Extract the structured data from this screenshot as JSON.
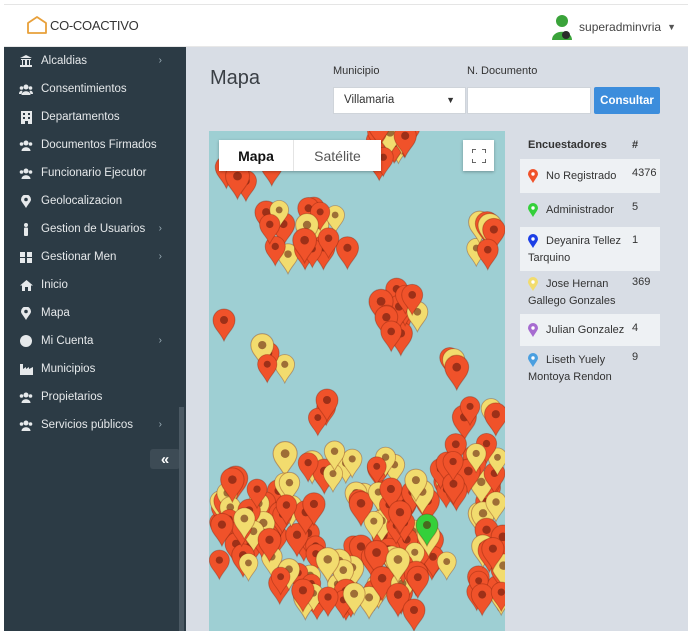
{
  "app": {
    "logo_text": "CO-COACTIVO",
    "user_name": "superadminvria"
  },
  "sidebar": {
    "items": [
      {
        "label": "Alcaldias",
        "icon": "bank-icon",
        "has_children": true
      },
      {
        "label": "Consentimientos",
        "icon": "users-icon",
        "has_children": false
      },
      {
        "label": "Departamentos",
        "icon": "building-icon",
        "has_children": false
      },
      {
        "label": "Documentos Firmados",
        "icon": "users-icon",
        "has_children": false
      },
      {
        "label": "Funcionario Ejecutor",
        "icon": "users-icon",
        "has_children": false
      },
      {
        "label": "Geolocalizacion",
        "icon": "map-marker-icon",
        "has_children": false
      },
      {
        "label": "Gestion de Usuarios",
        "icon": "person-icon",
        "has_children": true
      },
      {
        "label": "Gestionar Men",
        "icon": "grid-icon",
        "has_children": true
      },
      {
        "label": "Inicio",
        "icon": "home-icon",
        "has_children": false
      },
      {
        "label": "Mapa",
        "icon": "map-marker-icon",
        "has_children": false
      },
      {
        "label": "Mi Cuenta",
        "icon": "circle-icon",
        "has_children": true
      },
      {
        "label": "Municipios",
        "icon": "industry-icon",
        "has_children": false
      },
      {
        "label": "Propietarios",
        "icon": "users-icon",
        "has_children": false
      },
      {
        "label": "Servicios públicos",
        "icon": "users-icon",
        "has_children": true
      }
    ],
    "collapse_label": "«"
  },
  "main": {
    "title": "Mapa",
    "municipio_label": "Municipio",
    "municipio_value": "Villamaria",
    "documento_label": "N. Documento",
    "documento_value": "",
    "consultar_label": "Consultar"
  },
  "map": {
    "tab_map": "Mapa",
    "tab_satellite": "Satélite",
    "water_color": "#9ecfd3"
  },
  "legend": {
    "header_name": "Encuestadores",
    "header_count": "#",
    "rows": [
      {
        "name": "No Registrado",
        "count": "4376",
        "color": "#f0522a"
      },
      {
        "name": "Administrador",
        "count": "5",
        "color": "#34d03a"
      },
      {
        "name": "Deyanira Tellez Tarquino",
        "count": "1",
        "color": "#1c3fe6"
      },
      {
        "name": "Jose Hernan Gallego Gonzales",
        "count": "369",
        "color": "#f2dc6e"
      },
      {
        "name": "Julian Gonzalez",
        "count": "4",
        "color": "#a66bd0"
      },
      {
        "name": "Liseth Yuely Montoya Rendon",
        "count": "9",
        "color": "#4a9fe0"
      }
    ]
  }
}
